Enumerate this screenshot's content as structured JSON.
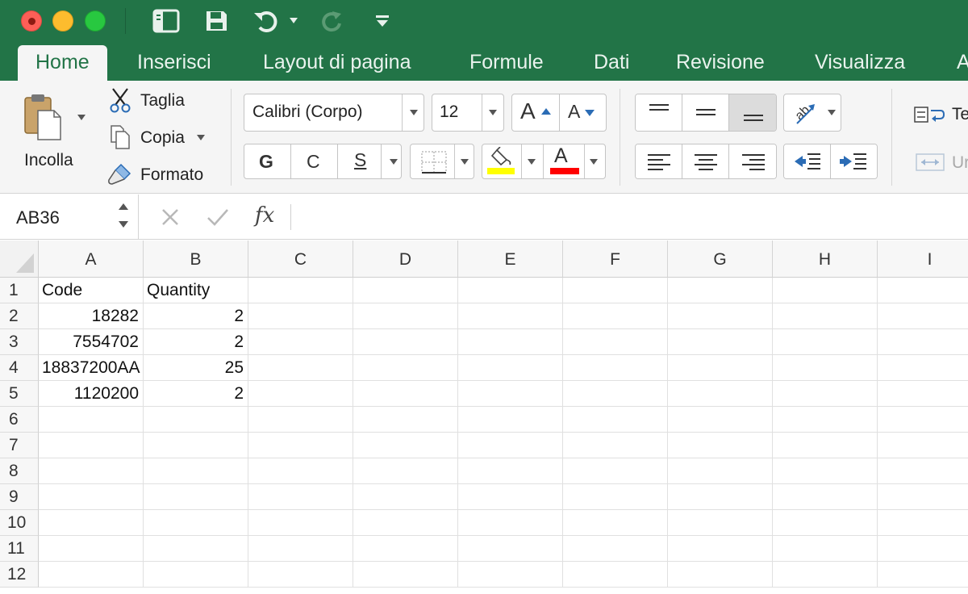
{
  "titlebar": {
    "quick_access": [
      "sidebar-toggle-icon",
      "save-icon",
      "undo-icon",
      "redo-icon",
      "customize-toolbar-icon"
    ]
  },
  "tabs": [
    {
      "label": "Home",
      "active": true
    },
    {
      "label": "Inserisci"
    },
    {
      "label": "Layout di pagina"
    },
    {
      "label": "Formule"
    },
    {
      "label": "Dati"
    },
    {
      "label": "Revisione"
    },
    {
      "label": "Visualizza"
    },
    {
      "label": "A"
    }
  ],
  "ribbon": {
    "clipboard": {
      "paste_label": "Incolla",
      "cut_label": "Taglia",
      "copy_label": "Copia",
      "format_label": "Formato"
    },
    "font": {
      "font_name": "Calibri (Corpo)",
      "font_size": "12",
      "grow_label": "A",
      "shrink_label": "A",
      "bold_label": "G",
      "italic_label": "C",
      "underline_label": "S",
      "font_color_label": "A",
      "fill_color": "#ffff00",
      "font_color": "#ff0000"
    },
    "wrap": {
      "label": "Te"
    },
    "merge": {
      "label": "Ur"
    }
  },
  "formula_bar": {
    "name_box": "AB36",
    "fx_label": "fx",
    "value": ""
  },
  "sheet": {
    "columns": [
      "A",
      "B",
      "C",
      "D",
      "E",
      "F",
      "G",
      "H",
      "I"
    ],
    "row_numbers": [
      "1",
      "2",
      "3",
      "4",
      "5",
      "6",
      "7",
      "8",
      "9",
      "10",
      "11",
      "12"
    ],
    "rows": [
      [
        "Code",
        "Quantity"
      ],
      [
        "18282",
        "2"
      ],
      [
        "7554702",
        "2"
      ],
      [
        "18837200AA",
        "25"
      ],
      [
        "1120200",
        "2"
      ]
    ]
  },
  "colors": {
    "accent": "#227447",
    "ribbon_bg": "#f5f5f5"
  }
}
